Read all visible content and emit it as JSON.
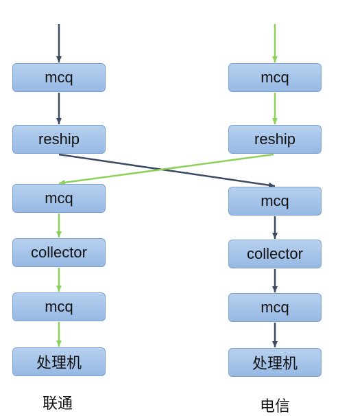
{
  "left_column": {
    "label": "联通",
    "boxes": [
      "mcq",
      "reship",
      "mcq",
      "collector",
      "mcq",
      "处理机"
    ]
  },
  "right_column": {
    "label": "电信",
    "boxes": [
      "mcq",
      "reship",
      "mcq",
      "collector",
      "mcq",
      "处理机"
    ]
  },
  "colors": {
    "dark_arrow": "#3b4a63",
    "green_arrow": "#8cd05a",
    "box_border": "#7ea2cf",
    "box_fill_top": "#b7d0ee",
    "box_fill_bottom": "#96b9e4"
  }
}
